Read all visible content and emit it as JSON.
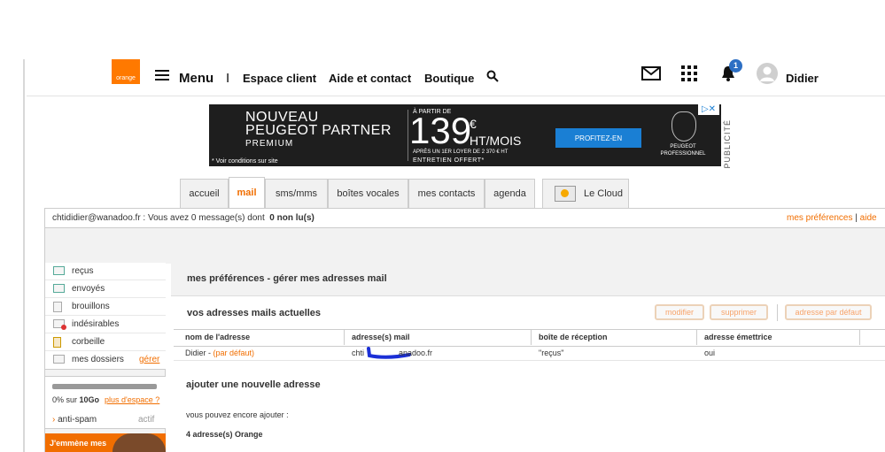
{
  "header": {
    "logo_text": "orange",
    "menu_label": "Menu",
    "separator": "I",
    "nav": [
      "Espace client",
      "Aide et contact",
      "Boutique"
    ],
    "notification_count": "1",
    "user_name": "Didier"
  },
  "ad": {
    "line1": "NOUVEAU",
    "line2": "PEUGEOT PARTNER",
    "line3": "PREMIUM",
    "conditions": "* Voir conditions sur site",
    "from": "À PARTIR DE",
    "price": "139",
    "euro": "€",
    "per_month": "HT/MOIS",
    "after": "APRÈS UN 1ER LOYER DE 2 370 € HT",
    "offer": "ENTRETIEN OFFERT*",
    "cta": "PROFITEZ-EN",
    "brand": "PEUGEOT PROFESSIONNEL",
    "publicite": "PUBLICITÉ"
  },
  "tabs": [
    "accueil",
    "mail",
    "sms/mms",
    "boîtes vocales",
    "mes contacts",
    "agenda",
    "Le Cloud"
  ],
  "active_tab": "mail",
  "account": {
    "text": "chtididier@wanadoo.fr : Vous avez 0 message(s) dont",
    "unread": "0 non lu(s)",
    "prefs_link": "mes préférences",
    "sep": "|",
    "help_link": "aide"
  },
  "sidebar": {
    "folders": [
      "reçus",
      "envoyés",
      "brouillons",
      "indésirables",
      "corbeille",
      "mes dossiers"
    ],
    "manage_link": "gérer",
    "quota_text": "0% sur",
    "quota_size": "10Go",
    "quota_link": "plus d'espace ?",
    "antispam_label": "anti-spam",
    "antispam_status": "actif",
    "promo_text": "J'emmène mes"
  },
  "main": {
    "title": "mes préférences - gérer mes adresses mail",
    "current_title": "vos adresses mails actuelles",
    "buttons": [
      "modifier",
      "supprimer",
      "adresse par défaut"
    ],
    "columns": [
      "nom de l'adresse",
      "adresse(s) mail",
      "boîte de réception",
      "adresse émettrice"
    ],
    "row": {
      "name": "Didier - ",
      "default": "(par défaut)",
      "mail_start": "chti",
      "mail_end": "anadoo.fr",
      "inbox": "\"reçus\"",
      "sender": "oui"
    },
    "add_title": "ajouter une nouvelle adresse",
    "can_add": "vous pouvez encore ajouter :",
    "count": "4 adresse(s) Orange"
  },
  "colors": {
    "orange": "#ff7900",
    "link": "#f16e00",
    "ad_bg": "#1e1e1e",
    "cta": "#1a7fd4",
    "badge": "#2d6fc4"
  }
}
